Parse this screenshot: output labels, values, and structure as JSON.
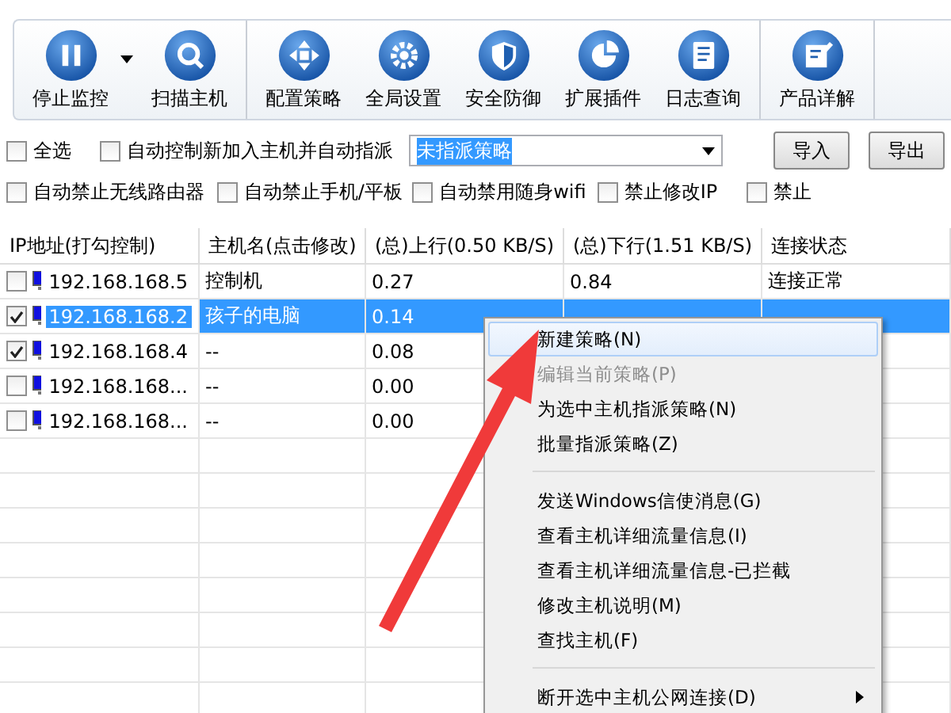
{
  "toolbar": {
    "groups": [
      [
        {
          "label": "停止监控",
          "has_dropdown": true
        },
        {
          "label": "扫描主机",
          "has_dropdown": false
        }
      ],
      [
        {
          "label": "配置策略",
          "has_dropdown": false
        },
        {
          "label": "全局设置",
          "has_dropdown": false
        },
        {
          "label": "安全防御",
          "has_dropdown": false
        },
        {
          "label": "扩展插件",
          "has_dropdown": false
        },
        {
          "label": "日志查询",
          "has_dropdown": false
        }
      ],
      [
        {
          "label": "产品详解",
          "has_dropdown": false
        }
      ]
    ]
  },
  "options_row": {
    "select_all": {
      "label": "全选",
      "checked": false
    },
    "auto_assign": {
      "label": "自动控制新加入主机并自动指派",
      "checked": false
    },
    "policy_select": {
      "value": "未指派策略"
    },
    "buttons": [
      "导入",
      "导出"
    ]
  },
  "restrictions": [
    {
      "label": "自动禁止无线路由器",
      "checked": false
    },
    {
      "label": "自动禁止手机/平板",
      "checked": false
    },
    {
      "label": "自动禁用随身wifi",
      "checked": false
    },
    {
      "label": "禁止修改IP",
      "checked": false
    },
    {
      "label": "禁止",
      "checked": false
    }
  ],
  "table": {
    "columns": [
      "IP地址(打勾控制)",
      "主机名(点击修改)",
      "(总)上行(0.50 KB/S)",
      "(总)下行(1.51 KB/S)",
      "连接状态"
    ],
    "rows": [
      {
        "checked": false,
        "selected": false,
        "cells": [
          "192.168.168.5",
          "控制机",
          "0.27",
          "0.84",
          "连接正常"
        ]
      },
      {
        "checked": true,
        "selected": true,
        "cells": [
          "192.168.168.2",
          "孩子的电脑",
          "0.14"
        ]
      },
      {
        "checked": true,
        "selected": false,
        "cells": [
          "192.168.168.4",
          "--",
          "0.08"
        ]
      },
      {
        "checked": false,
        "selected": false,
        "cells": [
          "192.168.168...",
          "--",
          "0.00"
        ]
      },
      {
        "checked": false,
        "selected": false,
        "cells": [
          "192.168.168...",
          "--",
          "0.00"
        ]
      }
    ]
  },
  "context_menu": {
    "items": [
      {
        "kind": "item",
        "label": "新建策略(N)",
        "disabled": false,
        "selected": true,
        "submenu": false
      },
      {
        "kind": "item",
        "label": "编辑当前策略(P)",
        "disabled": true,
        "selected": false,
        "submenu": false
      },
      {
        "kind": "item",
        "label": "为选中主机指派策略(N)",
        "disabled": false,
        "selected": false,
        "submenu": false
      },
      {
        "kind": "item",
        "label": "批量指派策略(Z)",
        "disabled": false,
        "selected": false,
        "submenu": false
      },
      {
        "kind": "separator"
      },
      {
        "kind": "item",
        "label": "发送Windows信使消息(G)",
        "disabled": false,
        "selected": false,
        "submenu": false
      },
      {
        "kind": "item",
        "label": "查看主机详细流量信息(I)",
        "disabled": false,
        "selected": false,
        "submenu": false
      },
      {
        "kind": "item",
        "label": "查看主机详细流量信息-已拦截",
        "disabled": false,
        "selected": false,
        "submenu": false
      },
      {
        "kind": "item",
        "label": "修改主机说明(M)",
        "disabled": false,
        "selected": false,
        "submenu": false
      },
      {
        "kind": "item",
        "label": "查找主机(F)",
        "disabled": false,
        "selected": false,
        "submenu": false
      },
      {
        "kind": "separator"
      },
      {
        "kind": "item",
        "label": "断开选中主机公网连接(D)",
        "disabled": false,
        "selected": false,
        "submenu": true
      }
    ]
  }
}
